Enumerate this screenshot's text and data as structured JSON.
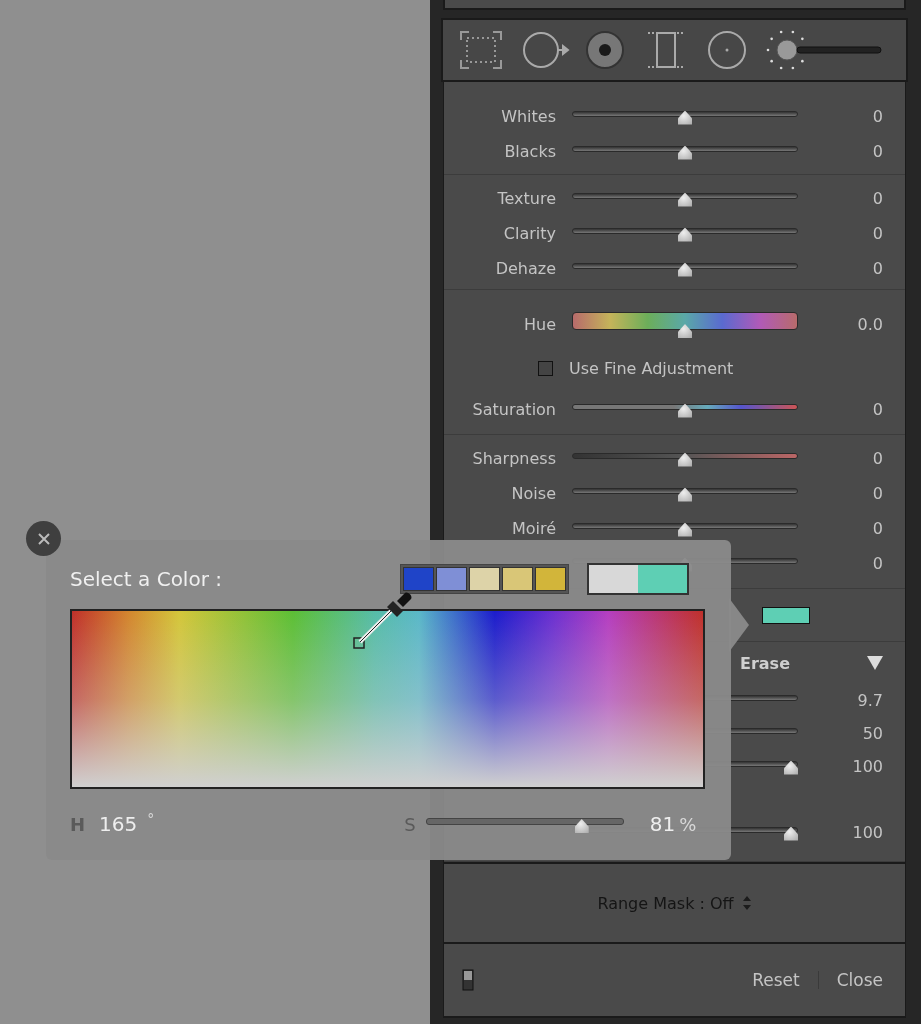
{
  "panel": {
    "sections": [
      {
        "rows": [
          {
            "kind": "slider",
            "label": "Whites",
            "value": "0",
            "level": 0.5
          },
          {
            "kind": "slider",
            "label": "Blacks",
            "value": "0",
            "level": 0.5
          }
        ]
      },
      {
        "rows": [
          {
            "kind": "slider",
            "label": "Texture",
            "value": "0",
            "level": 0.5
          },
          {
            "kind": "slider",
            "label": "Clarity",
            "value": "0",
            "level": 0.5
          },
          {
            "kind": "slider",
            "label": "Dehaze",
            "value": "0",
            "level": 0.5
          }
        ]
      },
      {
        "rows": [
          {
            "kind": "hue",
            "label": "Hue",
            "value": "0.0",
            "level": 0.5
          },
          {
            "kind": "checkbox",
            "label": "Use Fine Adjustment",
            "checked": false
          },
          {
            "kind": "saturation",
            "label": "Saturation",
            "value": "0",
            "level": 0.5
          }
        ]
      },
      {
        "rows": [
          {
            "kind": "sharpness",
            "label": "Sharpness",
            "value": "0",
            "level": 0.5
          },
          {
            "kind": "slider",
            "label": "Noise",
            "value": "0",
            "level": 0.5
          },
          {
            "kind": "slider",
            "label": "Moiré",
            "value": "0",
            "level": 0.5
          },
          {
            "kind": "slider",
            "value": "0",
            "level": 0.5
          }
        ]
      },
      {
        "rows": [
          {
            "kind": "color",
            "color": "#5ecfb4"
          }
        ]
      }
    ],
    "brush": {
      "title": "Erase",
      "rows": [
        {
          "value": "9.7"
        },
        {
          "value": "50"
        },
        {
          "value": "100",
          "level": 1
        },
        {
          "value": "100",
          "level": 1
        }
      ]
    },
    "range_mask": "Range Mask : Off",
    "footer": {
      "buttons": [
        "Reset",
        "Close"
      ]
    }
  },
  "color_picker": {
    "title": "Select a Color :",
    "swatches": [
      {
        "color": "#1f44c8"
      },
      {
        "color": "#7f8fd6"
      },
      {
        "color": "#ddd3a8"
      },
      {
        "color": "#d9c677"
      },
      {
        "color": "#d2b53a"
      }
    ],
    "compare": [
      {
        "color": "#d8d8d8"
      },
      {
        "color": "#5ecfb4"
      }
    ],
    "hue": {
      "label": "H",
      "value": "165",
      "unit": "°"
    },
    "saturation": {
      "label": "S",
      "level": 0.81,
      "value": "81",
      "unit": "%"
    }
  }
}
